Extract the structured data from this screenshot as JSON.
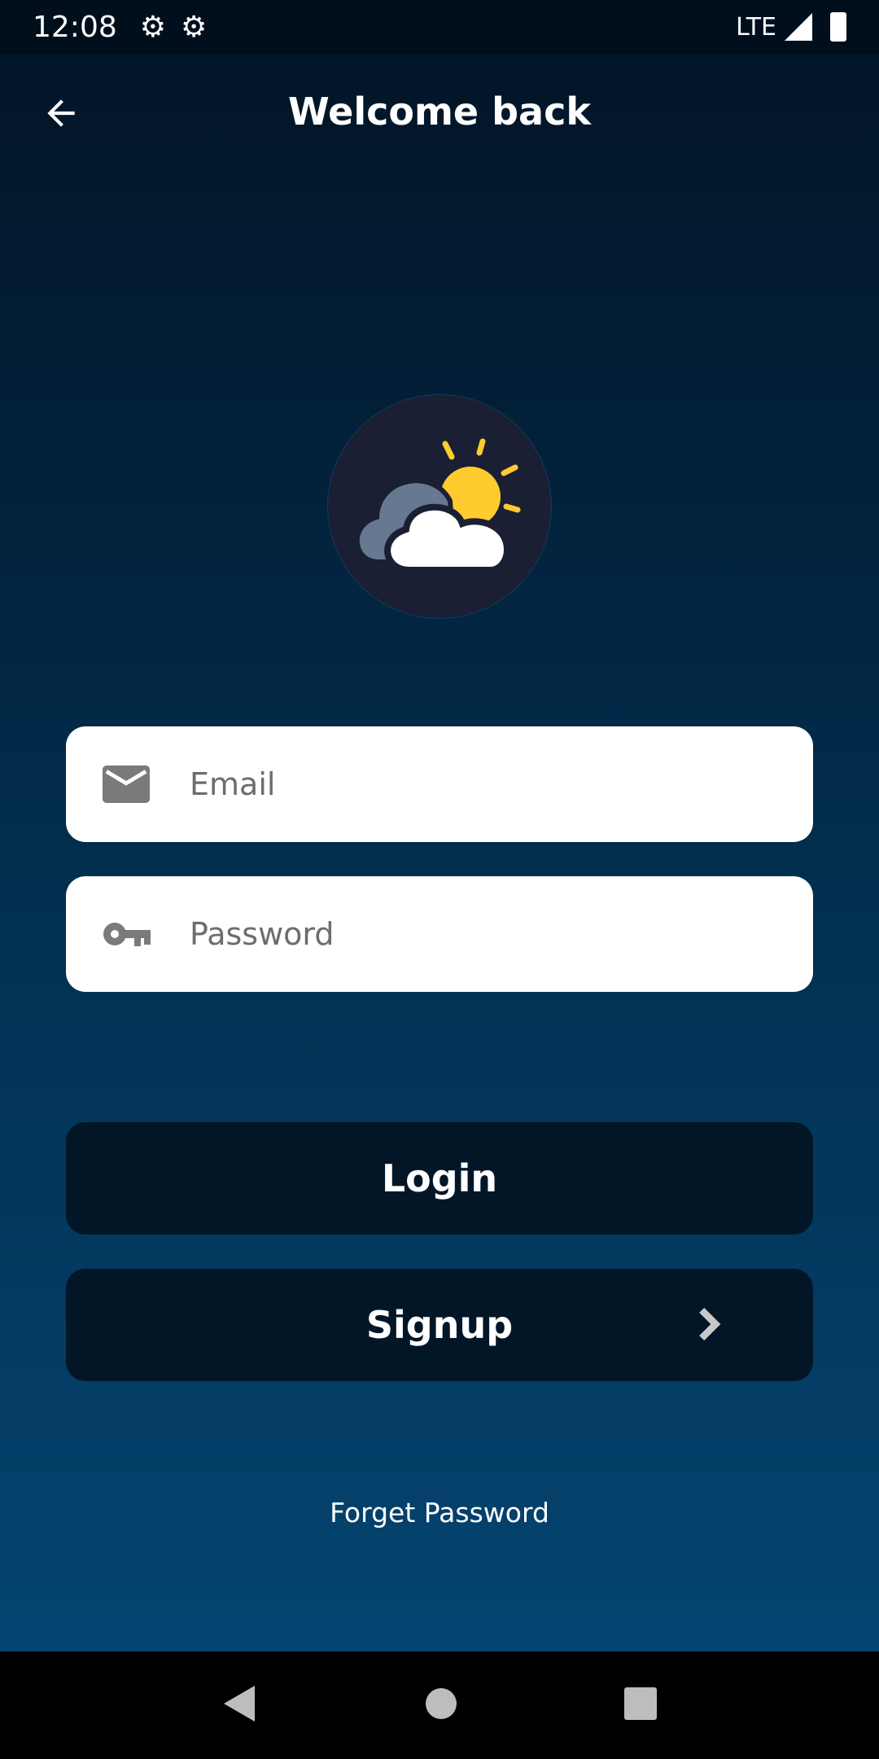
{
  "status_bar": {
    "time": "12:08",
    "network": "LTE"
  },
  "header": {
    "title": "Welcome back"
  },
  "form": {
    "email_placeholder": "Email",
    "password_placeholder": "Password"
  },
  "buttons": {
    "login": "Login",
    "signup": "Signup",
    "forgot": "Forget Password"
  },
  "colors": {
    "sun": "#ffcb2f",
    "cloud_back": "#677891",
    "cloud_front": "#ffffff",
    "logo_bg": "#1a1f33",
    "button_bg": "#021628"
  }
}
